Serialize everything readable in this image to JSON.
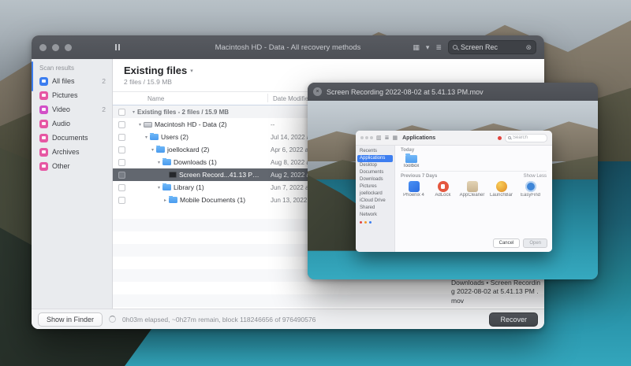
{
  "colors": {
    "accent_blue": "#3b7df0",
    "category_pink": "#e657a3",
    "selection_gray": "#62676f",
    "water_teal": "#2b97ad"
  },
  "icons": {
    "chevron_down": "▾",
    "chevron_right": "▸",
    "grid_view": "▦",
    "list_view": "≣",
    "sidebar_toggle": "▥",
    "clear": "⊗",
    "close": "×"
  },
  "main_window": {
    "titlebar": {
      "title": "Macintosh HD - Data - All recovery methods",
      "search": {
        "value": "Screen Rec"
      }
    },
    "sidebar": {
      "section": "Scan results",
      "items": [
        {
          "label": "All files",
          "count": "2"
        },
        {
          "label": "Pictures",
          "count": ""
        },
        {
          "label": "Video",
          "count": "2"
        },
        {
          "label": "Audio",
          "count": ""
        },
        {
          "label": "Documents",
          "count": ""
        },
        {
          "label": "Archives",
          "count": ""
        },
        {
          "label": "Other",
          "count": ""
        }
      ]
    },
    "content": {
      "title": "Existing files",
      "subtitle": "2 files / 15.9 MB",
      "columns": {
        "name": "Name",
        "date": "Date Modified"
      },
      "group_row": {
        "name": "Existing files - 2 files / 15.9 MB"
      },
      "rows": [
        {
          "name": "Macintosh HD - Data (2)",
          "date": "--"
        },
        {
          "name": "Users (2)",
          "date": "Jul 14, 2022 at 4:2..."
        },
        {
          "name": "joellockard (2)",
          "date": "Apr 6, 2022 at 10:4..."
        },
        {
          "name": "Downloads (1)",
          "date": "Aug 8, 2022 at 11:1..."
        },
        {
          "name": "Screen Record...41.13 PM.mov",
          "date": "Aug 2, 2022 at 5:41..."
        },
        {
          "name": "Library (1)",
          "date": "Jun 7, 2022 at 11:0..."
        },
        {
          "name": "Mobile Documents (1)",
          "date": "Jun 13, 2022 at 4:2..."
        }
      ],
      "details": "Downloads • Screen Recording 2022-08-02 at 5.41.13 PM .mov"
    },
    "footer": {
      "show_in_finder": "Show in Finder",
      "status": "0h03m elapsed, ~0h27m remain, block 118246656 of 976490576",
      "recover": "Recover"
    }
  },
  "preview_window": {
    "title": "Screen Recording 2022-08-02 at 5.41.13 PM.mov",
    "finder": {
      "toolbar": {
        "title": "Applications",
        "search_placeholder": "Search"
      },
      "sidebar": [
        "Recents",
        "Applications",
        "Desktop",
        "Documents",
        "Downloads",
        "Pictures",
        "joellockard",
        "iCloud Drive",
        "Shared",
        "Network"
      ],
      "today": {
        "label": "Today",
        "item": "Toolbox"
      },
      "previous": {
        "label": "Previous 7 Days",
        "action": "Show Less"
      },
      "apps": [
        {
          "name": "Phoenix 4"
        },
        {
          "name": "AdLock"
        },
        {
          "name": "AppCleaner"
        },
        {
          "name": "LaunchBar"
        },
        {
          "name": "EasyFind"
        }
      ],
      "cancel": "Cancel",
      "open": "Open"
    }
  }
}
